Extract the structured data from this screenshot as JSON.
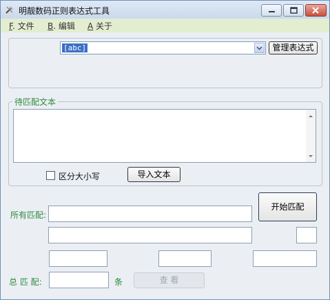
{
  "window": {
    "title": "明靓数码正则表达式工具"
  },
  "menu": [
    {
      "key": "F",
      "label": ". 文件"
    },
    {
      "key": "B",
      "label": ". 编辑"
    },
    {
      "key": "A",
      "label": " 关于"
    }
  ],
  "pattern": {
    "value": "[abc]",
    "manage_button": "管理表达式"
  },
  "text_panel": {
    "legend": "待匹配文本",
    "text": "",
    "case_checkbox_label": "区分大小写",
    "case_checked": false,
    "import_button": "导入文本"
  },
  "match": {
    "all_label": "所有匹配:",
    "start_button": "开始匹配",
    "total_label": "总  匹  配:",
    "unit": "条",
    "view_button": "查   看"
  }
}
